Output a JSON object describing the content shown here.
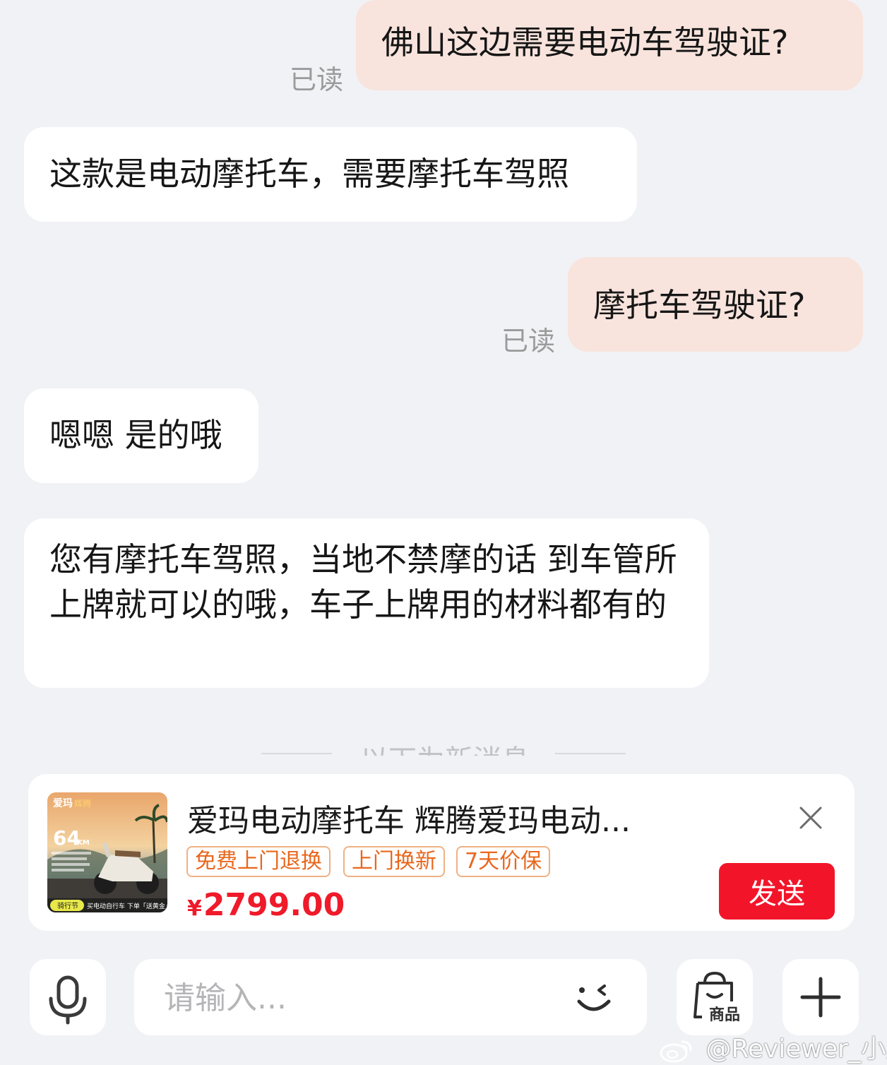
{
  "chat": {
    "read_label": "已读",
    "messages": [
      {
        "side": "mine",
        "text": "佛山这边需要电动车驾驶证?"
      },
      {
        "side": "theirs",
        "text": "这款是电动摩托车，需要摩托车驾照"
      },
      {
        "side": "mine",
        "text": "摩托车驾驶证?"
      },
      {
        "side": "theirs",
        "text": "嗯嗯 是的哦"
      },
      {
        "side": "theirs",
        "text": "您有摩托车驾照，当地不禁摩的话 到车管所上牌就可以的哦，车子上牌用的材料都有的"
      }
    ],
    "new_messages_divider": "以下为新消息"
  },
  "product_card": {
    "title": "爱玛电动摩托车 辉腾爱玛电动...",
    "tags": [
      "免费上门退换",
      "上门换新",
      "7天价保"
    ],
    "price_symbol": "¥",
    "price": "2799.00",
    "send_label": "发送",
    "thumbnail": {
      "brand": "爱玛",
      "model": "辉腾",
      "range": "64",
      "range_unit": "KM",
      "footer": "买电动自行车 下单「送黄金」",
      "badge": "骑行节"
    }
  },
  "input_bar": {
    "placeholder": "请输入...",
    "goods_label": "商品"
  },
  "watermark": "@Reviewer_小康",
  "colors": {
    "background": "#f1f2f6",
    "my_bubble": "#f8e4dd",
    "their_bubble": "#ffffff",
    "price": "#ef1a2a",
    "send_button": "#f2152a",
    "tag_text": "#e8671d"
  }
}
